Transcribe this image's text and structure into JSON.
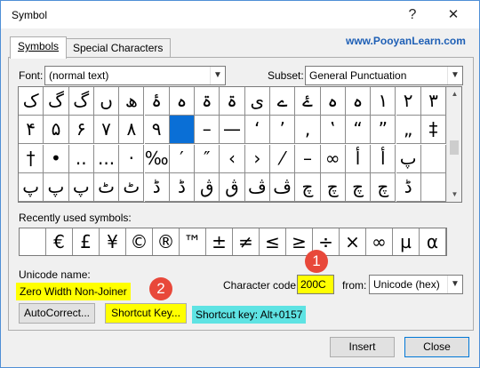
{
  "window": {
    "title": "Symbol",
    "help_label": "?",
    "close_label": "✕"
  },
  "tabs": [
    {
      "label": "Symbols"
    },
    {
      "label": "Special Characters"
    }
  ],
  "watermark": "www.PooyanLearn.com",
  "font": {
    "label": "Font:",
    "value": "(normal text)"
  },
  "subset": {
    "label": "Subset:",
    "value": "General Punctuation"
  },
  "grid_rows": [
    [
      "ک",
      "گ",
      "گ",
      "ں",
      "ھ",
      "ۂ",
      "ہ",
      "ۃ",
      "ۃ",
      "ی",
      "ے",
      "ۓ",
      "ہ",
      "ہ",
      "۱",
      "۲",
      "۳"
    ],
    [
      "۴",
      "۵",
      "۶",
      "۷",
      "۸",
      "۹",
      "",
      "–",
      "—",
      "‘",
      "’",
      "‚",
      "‛",
      "“",
      "”",
      "„",
      "‡"
    ],
    [
      "†",
      "•",
      "..",
      "...",
      "·",
      "‰",
      "′",
      "″",
      "‹",
      "›",
      "⁄",
      "–",
      "∞",
      "أ",
      "أ",
      "پ",
      ""
    ],
    [
      "پ",
      "پ",
      "پ",
      "ٹ",
      "ٹ",
      "ڈ",
      "ڈ",
      "ڨ",
      "ڨ",
      "ڤ",
      "ڤ",
      "چ",
      "چ",
      "چ",
      "چ",
      "ڈ",
      ""
    ]
  ],
  "recent": {
    "label": "Recently used symbols:",
    "symbols": [
      "",
      "€",
      "£",
      "¥",
      "©",
      "®",
      "™",
      "±",
      "≠",
      "≤",
      "≥",
      "÷",
      "×",
      "∞",
      "µ",
      "α"
    ]
  },
  "unicode_name": {
    "label": "Unicode name:",
    "value": "Zero Width Non-Joiner"
  },
  "char_code": {
    "label": "Character code:",
    "value": "200C"
  },
  "from": {
    "label": "from:",
    "value": "Unicode (hex)"
  },
  "buttons": {
    "autocorrect": "AutoCorrect...",
    "shortcut": "Shortcut Key...",
    "insert": "Insert",
    "close": "Close"
  },
  "shortcut_info": "Shortcut key: Alt+0157",
  "badges": [
    "1",
    "2"
  ]
}
